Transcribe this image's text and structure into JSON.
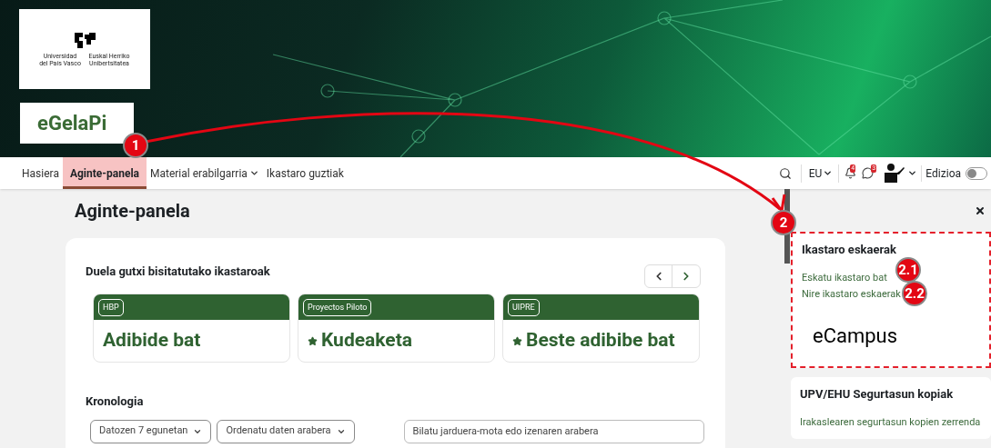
{
  "header": {
    "logo_texts": [
      "Universidad del País Vasco",
      "Euskal Herriko Unibertsitatea"
    ],
    "site_name": "eGelaPi"
  },
  "nav": {
    "items": [
      {
        "label": "Hasiera",
        "selected": false,
        "dropdown": false
      },
      {
        "label": "Aginte-panela",
        "selected": true,
        "dropdown": false
      },
      {
        "label": "Material erabilgarria",
        "selected": false,
        "dropdown": true
      },
      {
        "label": "Ikastaro guztiak",
        "selected": false,
        "dropdown": false
      }
    ],
    "language": "EU",
    "notifications_count": "4",
    "messages_count": "3",
    "edit_mode": {
      "label": "Edizioa",
      "on": false
    }
  },
  "page_title": "Aginte-panela",
  "recent": {
    "title": "Duela gutxi bisitatutako ikastaroak",
    "courses": [
      {
        "category": "HBP",
        "name": "Adibide bat",
        "starred": false
      },
      {
        "category": "Proyectos Piloto",
        "name": "Kudeaketa",
        "starred": true
      },
      {
        "category": "UIPRE",
        "name": "Beste adibibe bat",
        "starred": true
      }
    ]
  },
  "timeline": {
    "title": "Kronologia",
    "filters": [
      "Datozen 7 egunetan",
      "Ordenatu daten arabera"
    ],
    "search": {
      "placeholder": "Bilatu jarduera-mota edo izenaren arabera"
    }
  },
  "drawer": {
    "blocks": [
      {
        "title": "Ikastaro eskaerak",
        "links": [
          "Eskatu ikastaro bat",
          "Nire ikastaro eskaerak"
        ],
        "logo_text": "eCampus",
        "highlighted": true
      },
      {
        "title": "UPV/EHU Segurtasun kopiak",
        "links": [
          "Irakaslearen segurtasun kopien zerrenda"
        ],
        "highlighted": false
      }
    ]
  },
  "annotations": [
    "1",
    "2",
    "2.1",
    "2.2"
  ]
}
